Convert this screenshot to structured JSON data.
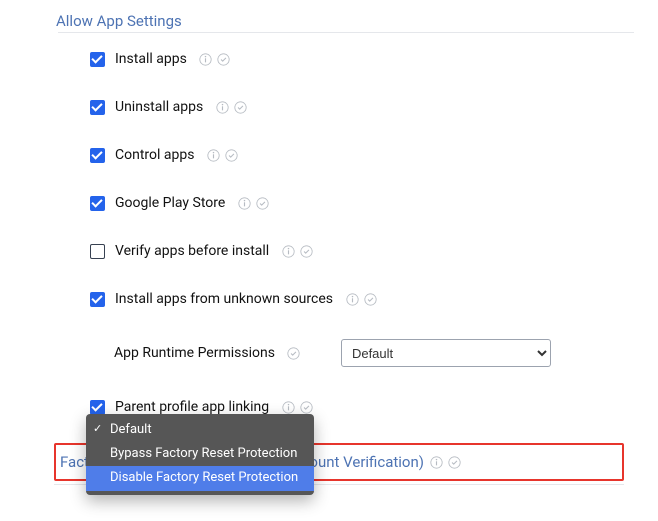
{
  "section": {
    "title": "Allow App Settings"
  },
  "settings": [
    {
      "label": "Install apps",
      "checked": true
    },
    {
      "label": "Uninstall apps",
      "checked": true
    },
    {
      "label": "Control apps",
      "checked": true
    },
    {
      "label": "Google Play Store",
      "checked": true
    },
    {
      "label": "Verify apps before install",
      "checked": false
    },
    {
      "label": "Install apps from unknown sources",
      "checked": true
    }
  ],
  "runtime": {
    "label": "App Runtime Permissions",
    "selected": "Default"
  },
  "parentLink": {
    "label": "Parent profile app linking",
    "checked": true
  },
  "frp": {
    "title": "Factory Reset Protection (Google Account Verification)"
  },
  "menu": {
    "items": [
      {
        "label": "Default",
        "checked": true,
        "selected": false
      },
      {
        "label": "Bypass Factory Reset Protection",
        "checked": false,
        "selected": false
      },
      {
        "label": "Disable Factory Reset Protection",
        "checked": false,
        "selected": true
      }
    ]
  }
}
